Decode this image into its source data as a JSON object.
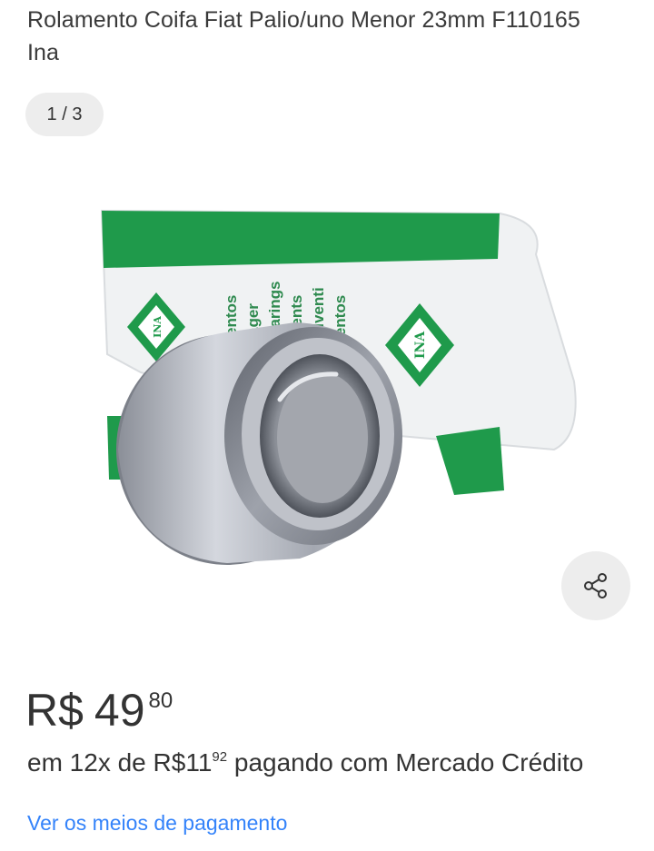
{
  "product": {
    "title": "Rolamento Coifa Fiat Palio/uno Menor 23mm F110165 Ina"
  },
  "gallery": {
    "counter": "1 / 3",
    "package_texts": [
      "entos",
      "ager",
      "earings",
      "nents",
      "i volventi",
      "mientos"
    ],
    "brand_logo_text": "INA"
  },
  "price": {
    "currency": "R$",
    "integer": "49",
    "cents": "80"
  },
  "installments": {
    "prefix": "em 12x de",
    "currency": "R$",
    "integer": "11",
    "cents": "92",
    "suffix": "pagando com Mercado Crédito"
  },
  "links": {
    "payment_methods": "Ver os meios de pagamento"
  },
  "colors": {
    "link_blue": "#3483fa",
    "package_green": "#1f9a4b",
    "chip_gray": "#ededed"
  },
  "icons": {
    "share": "share-icon"
  }
}
